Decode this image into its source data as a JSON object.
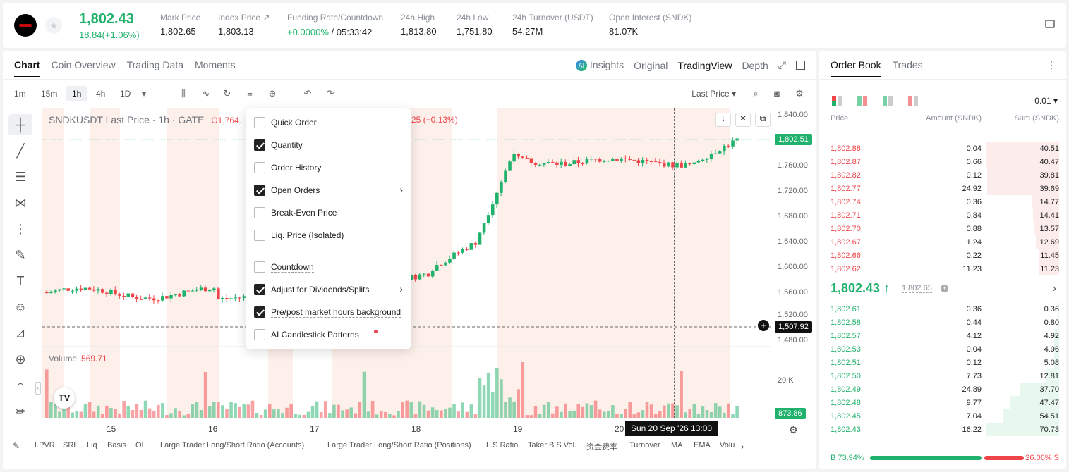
{
  "header": {
    "last_price": "1,802.43",
    "change": "18.84(+1.06%)",
    "stats": [
      {
        "label": "Mark Price",
        "value": "1,802.65"
      },
      {
        "label": "Index Price ↗",
        "value": "1,803.13"
      },
      {
        "label": "Funding Rate/Countdown",
        "value_green": "+0.0000%",
        "value": " / 05:33:42"
      },
      {
        "label": "24h High",
        "value": "1,813.80"
      },
      {
        "label": "24h Low",
        "value": "1,751.80"
      },
      {
        "label": "24h Turnover (USDT)",
        "value": "54.27M"
      },
      {
        "label": "Open Interest (SNDK)",
        "value": "81.07K"
      }
    ]
  },
  "chart_tabs": [
    "Chart",
    "Coin Overview",
    "Trading Data",
    "Moments"
  ],
  "view_tabs": {
    "insights": "Insights",
    "original": "Original",
    "tradingview": "TradingView",
    "depth": "Depth"
  },
  "intervals": [
    "1m",
    "15m",
    "1h",
    "4h",
    "1D"
  ],
  "price_type": "Last Price ▾",
  "chart_title": "SNDKUSDT Last Price · 1h · GATE",
  "ohlc_open_fragment": "O1,764.",
  "ohlc_change_fragment": "25 (−0.13%)",
  "volume_label": "Volume",
  "volume_value": "569.71",
  "price_ticks": [
    "1,840.00",
    "1,760.00",
    "1,720.00",
    "1,680.00",
    "1,640.00",
    "1,600.00",
    "1,560.00",
    "1,520.00",
    "1,480.00"
  ],
  "vol_tick": "20 K",
  "price_badge_last": "1,802.51",
  "price_badge_cross": "1,507.92",
  "vol_badge": "873.86",
  "date_ticks": [
    "15",
    "16",
    "17",
    "18",
    "19",
    "20"
  ],
  "date_tip": "Sun 20 Sep '26   13:00",
  "indicators": [
    "LPVR",
    "SRL",
    "Liq",
    "Basis",
    "OI",
    "Large Trader Long/Short Ratio (Accounts)",
    "Large Trader Long/Short Ratio (Positions)",
    "L.S Ratio",
    "Taker B.S Vol.",
    "资金费率",
    "Turnover",
    "MA",
    "EMA",
    "Volu"
  ],
  "menu": [
    {
      "label": "Quick Order",
      "checked": false,
      "arrow": false,
      "ul": false
    },
    {
      "label": "Quantity",
      "checked": true,
      "arrow": false,
      "ul": false
    },
    {
      "label": "Order History",
      "checked": false,
      "arrow": false,
      "ul": true
    },
    {
      "label": "Open Orders",
      "checked": true,
      "arrow": true,
      "ul": false
    },
    {
      "label": "Break-Even Price",
      "checked": false,
      "arrow": false,
      "ul": false
    },
    {
      "label": "Liq. Price (Isolated)",
      "checked": false,
      "arrow": false,
      "ul": false
    },
    {
      "label": "Countdown",
      "checked": false,
      "arrow": false,
      "ul": true
    },
    {
      "label": "Adjust for Dividends/Splits",
      "checked": true,
      "arrow": true,
      "ul": false
    },
    {
      "label": "Pre/post market hours background",
      "checked": true,
      "arrow": false,
      "ul": true
    },
    {
      "label": "AI Candlestick Patterns",
      "checked": false,
      "arrow": false,
      "ul": true
    }
  ],
  "orderbook": {
    "tabs": [
      "Order Book",
      "Trades"
    ],
    "precision": "0.01 ▾",
    "headers": {
      "price": "Price",
      "amount": "Amount (SNDK)",
      "sum": "Sum (SNDK)"
    },
    "asks": [
      {
        "price": "1,802.88",
        "amount": "0.04",
        "sum": "40.51",
        "depth": 1.0
      },
      {
        "price": "1,802.87",
        "amount": "0.66",
        "sum": "40.47",
        "depth": 0.999
      },
      {
        "price": "1,802.82",
        "amount": "0.12",
        "sum": "39.81",
        "depth": 0.983
      },
      {
        "price": "1,802.77",
        "amount": "24.92",
        "sum": "39.69",
        "depth": 0.98
      },
      {
        "price": "1,802.74",
        "amount": "0.36",
        "sum": "14.77",
        "depth": 0.365
      },
      {
        "price": "1,802.71",
        "amount": "0.84",
        "sum": "14.41",
        "depth": 0.356
      },
      {
        "price": "1,802.70",
        "amount": "0.88",
        "sum": "13.57",
        "depth": 0.335
      },
      {
        "price": "1,802.67",
        "amount": "1.24",
        "sum": "12.69",
        "depth": 0.313
      },
      {
        "price": "1,802.66",
        "amount": "0.22",
        "sum": "11.45",
        "depth": 0.283
      },
      {
        "price": "1,802.62",
        "amount": "11.23",
        "sum": "11.23",
        "depth": 0.277
      }
    ],
    "mid_price": "1,802.43 ↑",
    "mark_price": "1,802.65",
    "bids": [
      {
        "price": "1,802.61",
        "amount": "0.36",
        "sum": "0.36",
        "depth": 0.005
      },
      {
        "price": "1,802.58",
        "amount": "0.44",
        "sum": "0.80",
        "depth": 0.011
      },
      {
        "price": "1,802.57",
        "amount": "4.12",
        "sum": "4.92",
        "depth": 0.07
      },
      {
        "price": "1,802.53",
        "amount": "0.04",
        "sum": "4.96",
        "depth": 0.07
      },
      {
        "price": "1,802.51",
        "amount": "0.12",
        "sum": "5.08",
        "depth": 0.072
      },
      {
        "price": "1,802.50",
        "amount": "7.73",
        "sum": "12.81",
        "depth": 0.181
      },
      {
        "price": "1,802.49",
        "amount": "24.89",
        "sum": "37.70",
        "depth": 0.533
      },
      {
        "price": "1,802.48",
        "amount": "9.77",
        "sum": "47.47",
        "depth": 0.671
      },
      {
        "price": "1,802.45",
        "amount": "7.04",
        "sum": "54.51",
        "depth": 0.771
      },
      {
        "price": "1,802.43",
        "amount": "16.22",
        "sum": "70.73",
        "depth": 1.0
      }
    ],
    "buy_ratio": "B 73.94%",
    "sell_ratio": "26.06% S"
  },
  "colors": {
    "up": "#20b26c",
    "down": "#ef454a",
    "session_bg": "#fdf0ea"
  }
}
